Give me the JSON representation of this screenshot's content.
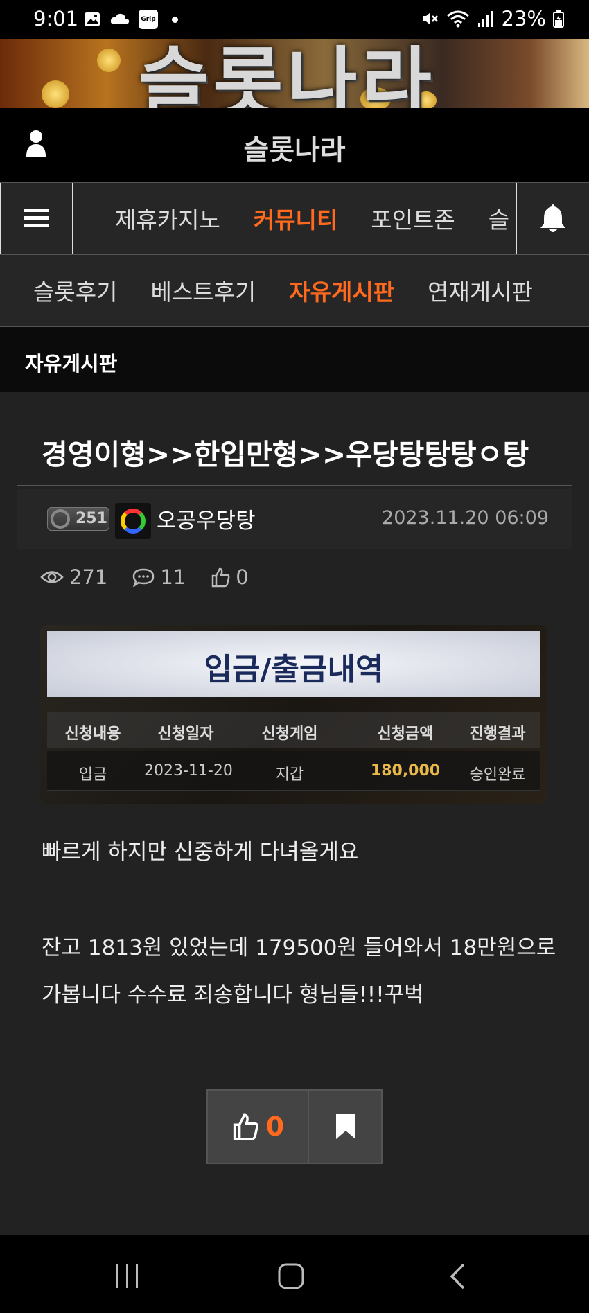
{
  "status_bar": {
    "time": "9:01",
    "battery": "23%",
    "left_icons": [
      "image-icon",
      "cloud-icon",
      "grip-app-icon",
      "dot-icon"
    ],
    "right_icons": [
      "mute-icon",
      "wifi-icon",
      "signal-icon",
      "battery-charging-icon"
    ],
    "grip_label": "Grip"
  },
  "banner": {
    "text": "슬롯나라"
  },
  "header": {
    "site_title": "슬롯나라",
    "icons": [
      "user-icon"
    ]
  },
  "main_nav": {
    "items": [
      {
        "label": "제휴카지노",
        "active": false
      },
      {
        "label": "커뮤니티",
        "active": true
      },
      {
        "label": "포인트존",
        "active": false
      },
      {
        "label": "슬",
        "active": false
      }
    ],
    "icons": [
      "menu-icon",
      "bell-icon"
    ]
  },
  "sub_nav": {
    "items": [
      {
        "label": "슬롯후기",
        "active": false
      },
      {
        "label": "베스트후기",
        "active": false
      },
      {
        "label": "자유게시판",
        "active": true
      },
      {
        "label": "연재게시판",
        "active": false
      }
    ]
  },
  "board": {
    "title": "자유게시판"
  },
  "post": {
    "title": "경영이형>>한입만형>>우당탕탕탕ㅇ탕",
    "author_level": "251",
    "author_name": "오공우당탕",
    "date": "2023.11.20 06:09",
    "views": "271",
    "comments": "11",
    "likes": "0",
    "body_lines": [
      "빠르게 하지만 신중하게 다녀올게요",
      "잔고 1813원 있었는데 179500원 들어와서 18만원으로",
      "가봅니다 수수료 죄송합니다 형님들!!!꾸벅"
    ],
    "like_button_count": "0"
  },
  "slip_image": {
    "title": "입금/출금내역",
    "headers": [
      "신청내용",
      "신청일자",
      "신청게임",
      "신청금액",
      "진행결과"
    ],
    "row": [
      "입금",
      "2023-11-20",
      "지갑",
      "180,000",
      "승인완료"
    ]
  },
  "colors": {
    "accent": "#ff6a1f",
    "background": "#222222",
    "nav_background": "#262626",
    "amount": "#e8b84a"
  },
  "system_nav": {
    "icons": [
      "recents-icon",
      "home-icon",
      "back-icon"
    ]
  }
}
